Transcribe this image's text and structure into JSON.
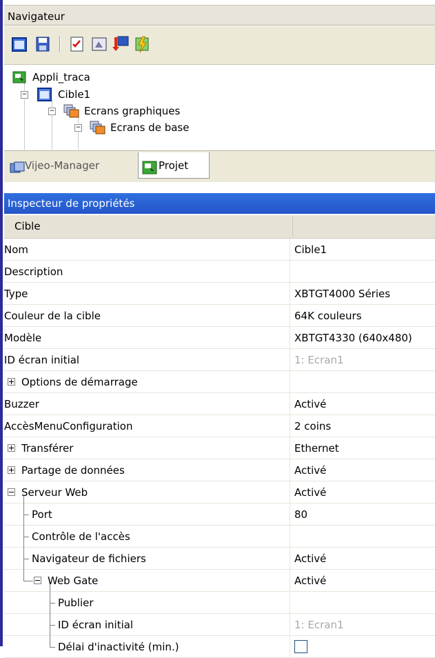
{
  "navigator": {
    "title": "Navigateur",
    "toolbar": [
      "new-target-icon",
      "save-icon",
      "checklist-icon",
      "screen-icon",
      "download-icon",
      "build-icon"
    ],
    "tree": [
      {
        "label": "Appli_traca",
        "icon": "app-icon"
      },
      {
        "label": "Cible1",
        "icon": "target-icon",
        "expanded": true
      },
      {
        "label": "Ecrans graphiques",
        "icon": "screens-folder-icon",
        "expanded": true
      },
      {
        "label": "Ecrans de base",
        "icon": "screens-folder-icon",
        "expanded": true
      }
    ],
    "tabs": [
      {
        "label": "Vijeo-Manager",
        "icon": "vijeo-manager-icon",
        "active": false
      },
      {
        "label": "Projet",
        "icon": "project-icon",
        "active": true
      }
    ]
  },
  "inspector": {
    "title": "Inspecteur de propriétés",
    "category": "Cible",
    "rows": [
      {
        "key": "Nom",
        "value": "Cible1"
      },
      {
        "key": "Description",
        "value": ""
      },
      {
        "key": "Type",
        "value": "XBTGT4000 Séries"
      },
      {
        "key": "Couleur de la cible",
        "value": "64K couleurs"
      },
      {
        "key": "Modèle",
        "value": "XBTGT4330 (640x480)"
      },
      {
        "key": "ID écran initial",
        "value": "1: Ecran1",
        "disabled": true
      },
      {
        "key": "Options de démarrage",
        "value": "",
        "expander": "plus"
      },
      {
        "key": "Buzzer",
        "value": "Activé"
      },
      {
        "key": "AccèsMenuConfiguration",
        "value": "2 coins"
      },
      {
        "key": "Transférer",
        "value": "Ethernet",
        "expander": "plus"
      },
      {
        "key": "Partage de données",
        "value": "Activé",
        "expander": "plus"
      },
      {
        "key": "Serveur Web",
        "value": "Activé",
        "expander": "minus"
      },
      {
        "key": "Port",
        "value": "80"
      },
      {
        "key": "Contrôle de l'accès",
        "value": ""
      },
      {
        "key": "Navigateur de fichiers",
        "value": "Activé"
      },
      {
        "key": "Web Gate",
        "value": "Activé",
        "expander": "minus"
      },
      {
        "key": "Publier",
        "value": ""
      },
      {
        "key": "ID écran initial",
        "value": "1: Ecran1",
        "disabled": true
      },
      {
        "key": "Délai d'inactivité (min.)",
        "value": "",
        "checkbox": true
      }
    ]
  }
}
